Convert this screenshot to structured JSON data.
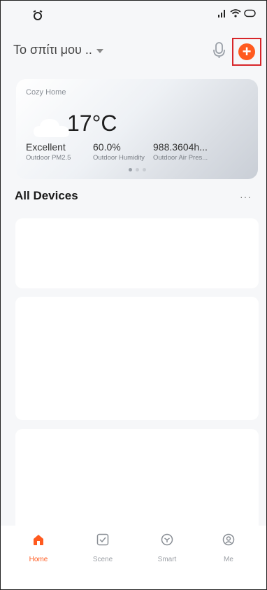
{
  "header": {
    "home_title": "Το σπίτι μου .."
  },
  "weather": {
    "location": "Cozy Home",
    "temperature": "17°C",
    "metrics": [
      {
        "value": "Excellent",
        "label": "Outdoor PM2.5"
      },
      {
        "value": "60.0%",
        "label": "Outdoor Humidity"
      },
      {
        "value": "988.3604h...",
        "label": "Outdoor Air Pres..."
      }
    ]
  },
  "devices": {
    "title": "All Devices",
    "more": "···"
  },
  "tabs": [
    {
      "label": "Home",
      "icon": "home-icon",
      "active": true
    },
    {
      "label": "Scene",
      "icon": "scene-icon",
      "active": false
    },
    {
      "label": "Smart",
      "icon": "smart-icon",
      "active": false
    },
    {
      "label": "Me",
      "icon": "profile-icon",
      "active": false
    }
  ],
  "colors": {
    "accent": "#ff5a1f",
    "highlight_box": "#d7262a"
  }
}
